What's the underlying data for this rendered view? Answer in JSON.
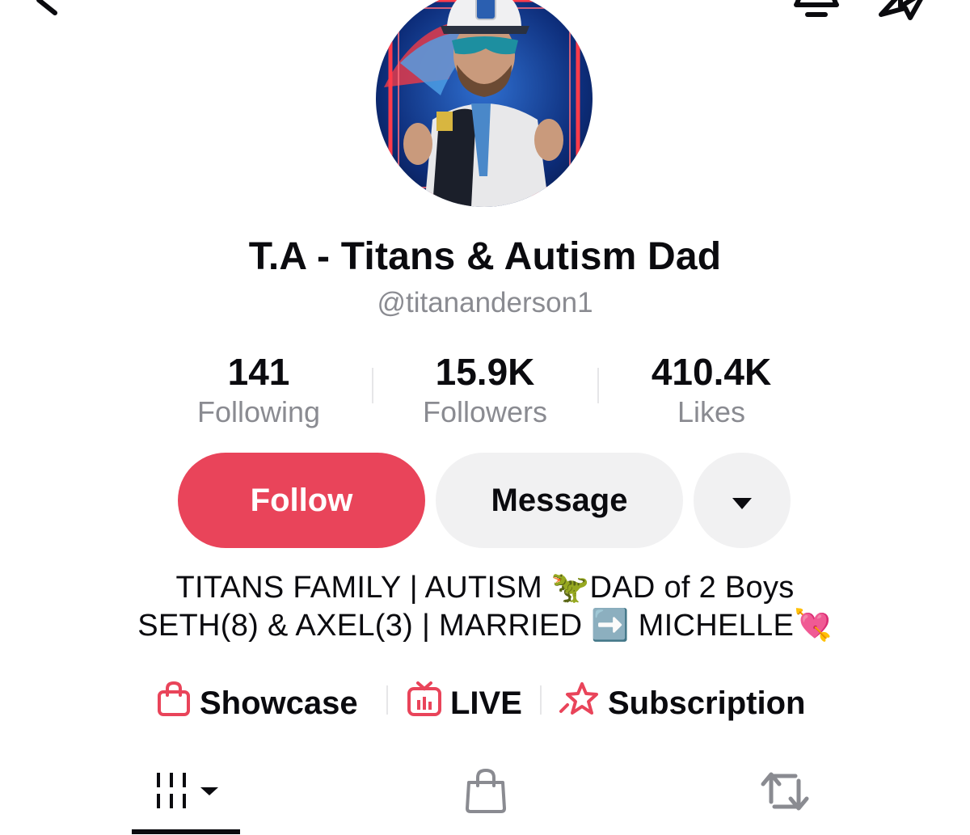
{
  "profile": {
    "display_name": "T.A - Titans & Autism Dad",
    "username": "@titananderson1"
  },
  "stats": {
    "following": {
      "value": "141",
      "label": "Following"
    },
    "followers": {
      "value": "15.9K",
      "label": "Followers"
    },
    "likes": {
      "value": "410.4K",
      "label": "Likes"
    }
  },
  "actions": {
    "follow_label": "Follow",
    "message_label": "Message"
  },
  "bio": {
    "line1": "TITANS FAMILY | AUTISM 🦖DAD of 2 Boys",
    "line2": "SETH(8) & AXEL(3) | MARRIED ➡️ MICHELLE💘"
  },
  "links": {
    "showcase": "Showcase",
    "live": "LIVE",
    "subscription": "Subscription"
  },
  "icons": [
    "back-icon",
    "bell-icon",
    "share-icon",
    "chevron-down-icon",
    "shopping-bag-icon",
    "tv-icon",
    "star-icon",
    "grid-icon",
    "repost-icon"
  ],
  "colors": {
    "accent": "#e9445a",
    "secondary_button": "#f1f1f2",
    "muted_text": "#8a8b91",
    "text": "#0b0b0f"
  },
  "tabs": {
    "active": "videos"
  }
}
